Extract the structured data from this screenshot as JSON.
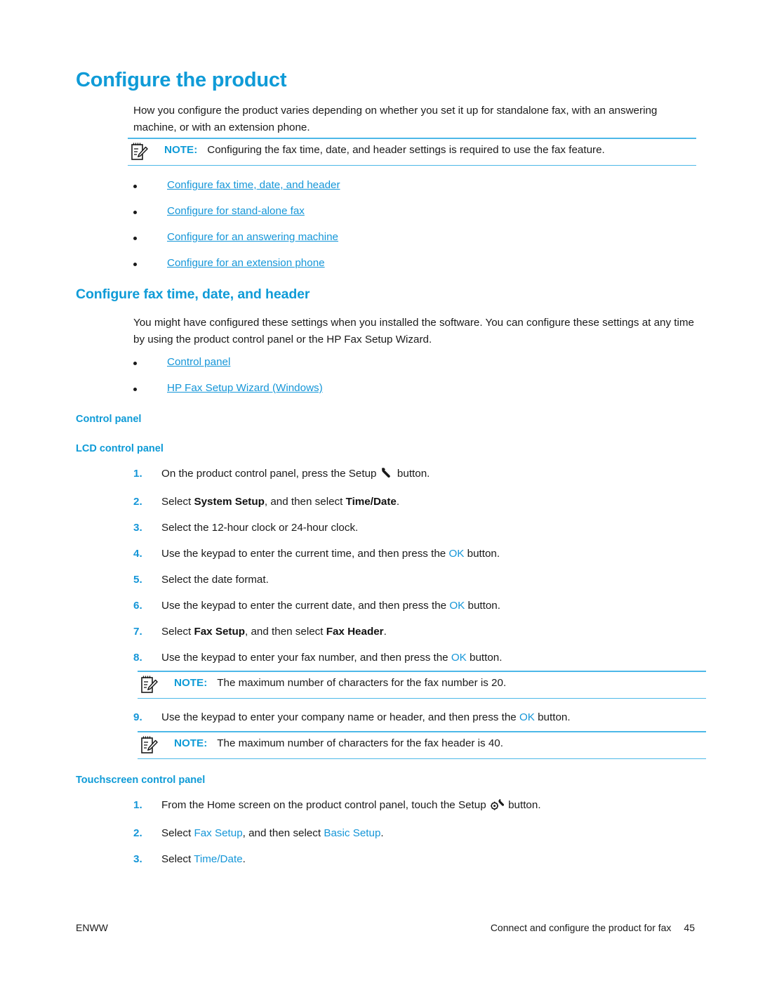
{
  "page": {
    "title": "Configure the product",
    "intro_paragraph": "How you configure the product varies depending on whether you set it up for standalone fax, with an answering machine, or with an extension phone."
  },
  "top_note": {
    "icon": "note-pencil-icon",
    "label": "NOTE:",
    "text": "Configuring the fax time, date, and header settings is required to use the fax feature."
  },
  "top_links": [
    {
      "label": "Configure fax time, date, and header"
    },
    {
      "label": "Configure for stand-alone fax"
    },
    {
      "label": "Configure for an answering machine"
    },
    {
      "label": "Configure for an extension phone"
    }
  ],
  "section_fax_time": {
    "heading": "Configure fax time, date, and header",
    "paragraph": "You might have configured these settings when you installed the software. You can configure these settings at any time by using the product control panel or the HP Fax Setup Wizard.",
    "links": [
      {
        "label": "Control panel"
      },
      {
        "label": "HP Fax Setup Wizard (Windows)"
      }
    ]
  },
  "control_panel": {
    "heading": "Control panel",
    "lcd_heading": "LCD control panel",
    "steps": [
      {
        "num": "1.",
        "parts": [
          {
            "type": "text",
            "value": "On the product control panel, press the Setup "
          },
          {
            "type": "icon",
            "value": "wrench-icon"
          },
          {
            "type": "text",
            "value": " button."
          }
        ]
      },
      {
        "num": "2.",
        "parts": [
          {
            "type": "text",
            "value": "Select "
          },
          {
            "type": "bold",
            "value": "System Setup"
          },
          {
            "type": "text",
            "value": ", and then select "
          },
          {
            "type": "bold",
            "value": "Time/Date"
          },
          {
            "type": "text",
            "value": "."
          }
        ]
      },
      {
        "num": "3.",
        "parts": [
          {
            "type": "text",
            "value": "Select the 12-hour clock or 24-hour clock."
          }
        ]
      },
      {
        "num": "4.",
        "parts": [
          {
            "type": "text",
            "value": "Use the keypad to enter the current time, and then press the "
          },
          {
            "type": "blue",
            "value": "OK"
          },
          {
            "type": "text",
            "value": " button."
          }
        ]
      },
      {
        "num": "5.",
        "parts": [
          {
            "type": "text",
            "value": "Select the date format."
          }
        ]
      },
      {
        "num": "6.",
        "parts": [
          {
            "type": "text",
            "value": "Use the keypad to enter the current date, and then press the "
          },
          {
            "type": "blue",
            "value": "OK"
          },
          {
            "type": "text",
            "value": " button."
          }
        ]
      },
      {
        "num": "7.",
        "parts": [
          {
            "type": "text",
            "value": "Select "
          },
          {
            "type": "bold",
            "value": "Fax Setup"
          },
          {
            "type": "text",
            "value": ", and then select "
          },
          {
            "type": "bold",
            "value": "Fax Header"
          },
          {
            "type": "text",
            "value": "."
          }
        ]
      },
      {
        "num": "8.",
        "parts": [
          {
            "type": "text",
            "value": "Use the keypad to enter your fax number, and then press the "
          },
          {
            "type": "blue",
            "value": "OK"
          },
          {
            "type": "text",
            "value": " button."
          }
        ]
      }
    ],
    "note_fax_number": {
      "icon": "note-pencil-icon",
      "label": "NOTE:",
      "text": "The maximum number of characters for the fax number is 20."
    },
    "step_nine": {
      "num": "9.",
      "parts": [
        {
          "type": "text",
          "value": "Use the keypad to enter your company name or header, and then press the "
        },
        {
          "type": "blue",
          "value": "OK"
        },
        {
          "type": "text",
          "value": " button."
        }
      ]
    },
    "note_fax_header": {
      "icon": "note-pencil-icon",
      "label": "NOTE:",
      "text": "The maximum number of characters for the fax header is 40."
    }
  },
  "touchscreen": {
    "heading": "Touchscreen control panel",
    "steps": [
      {
        "num": "1.",
        "parts": [
          {
            "type": "text",
            "value": "From the Home screen on the product control panel, touch the Setup "
          },
          {
            "type": "icon",
            "value": "gear-wrench-icon"
          },
          {
            "type": "text",
            "value": " button."
          }
        ]
      },
      {
        "num": "2.",
        "parts": [
          {
            "type": "text",
            "value": "Select "
          },
          {
            "type": "blue",
            "value": "Fax Setup"
          },
          {
            "type": "text",
            "value": ", and then select "
          },
          {
            "type": "blue",
            "value": "Basic Setup"
          },
          {
            "type": "text",
            "value": "."
          }
        ]
      },
      {
        "num": "3.",
        "parts": [
          {
            "type": "text",
            "value": "Select "
          },
          {
            "type": "blue",
            "value": "Time/Date"
          },
          {
            "type": "text",
            "value": "."
          }
        ]
      }
    ]
  },
  "footer": {
    "left": "ENWW",
    "right": "Connect and configure the product for fax",
    "page_number": "45"
  },
  "colors": {
    "accent_blue": "#0f9bd7",
    "link_blue": "#1596d8",
    "rule_blue": "#4db8e8",
    "text": "#1a1a1a"
  }
}
